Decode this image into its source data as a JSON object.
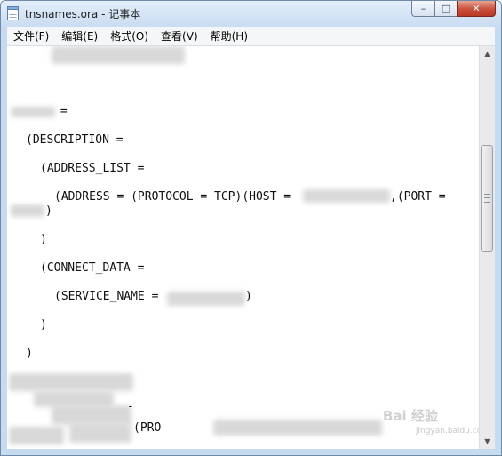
{
  "window": {
    "title": "tnsnames.ora - 记事本",
    "icon": "notepad-icon"
  },
  "caption_buttons": {
    "minimize": "minimize-icon",
    "maximize": "maximize-icon",
    "close": "close-icon",
    "minimize_glyph": "–",
    "maximize_glyph": "□",
    "close_glyph": "✕"
  },
  "menu": {
    "items": [
      {
        "label": "文件(F)"
      },
      {
        "label": "编辑(E)"
      },
      {
        "label": "格式(O)"
      },
      {
        "label": "查看(V)"
      },
      {
        "label": "帮助(H)"
      }
    ]
  },
  "editor": {
    "lines": [
      " =",
      "(DESCRIPTION =",
      "(ADDRESS_LIST =",
      "(ADDRESS = (PROTOCOL = TCP)(HOST =",
      ",(PORT =",
      ")",
      ")",
      "(CONNECT_DATA =",
      "(SERVICE_NAME =",
      ")",
      ")",
      ")",
      "-",
      "(PRO"
    ]
  },
  "scrollbar": {
    "up_arrow": "▲",
    "down_arrow": "▼",
    "up_icon": "scroll-up-icon",
    "down_icon": "scroll-down-icon"
  },
  "watermark": {
    "text": "Bai 经验",
    "sub": "jingyan.baidu.com"
  }
}
